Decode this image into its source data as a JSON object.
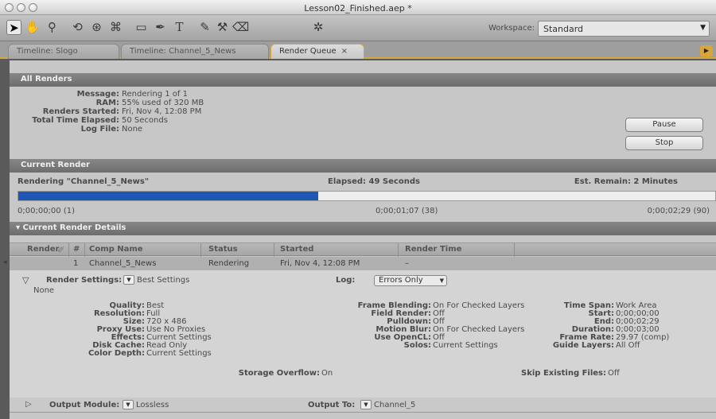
{
  "window": {
    "title": "Lesson02_Finished.aep *"
  },
  "toolbar": {
    "tools": [
      {
        "icon": "selection-arrow-icon",
        "glyph": "➤"
      },
      {
        "icon": "hand-icon",
        "glyph": "✋"
      },
      {
        "icon": "zoom-icon",
        "glyph": "⚲"
      },
      {
        "icon": "rotate-icon",
        "glyph": "⟲"
      },
      {
        "icon": "orbit-camera-icon",
        "glyph": "⊛"
      },
      {
        "icon": "pan-behind-icon",
        "glyph": "⌘"
      },
      {
        "icon": "rectangle-mask-icon",
        "glyph": "▭"
      },
      {
        "icon": "pen-icon",
        "glyph": "✒"
      },
      {
        "icon": "type-icon",
        "glyph": "T"
      },
      {
        "icon": "brush-icon",
        "glyph": "✎"
      },
      {
        "icon": "clone-stamp-icon",
        "glyph": "⚒"
      },
      {
        "icon": "eraser-icon",
        "glyph": "⌫"
      },
      {
        "icon": "puppet-pin-icon",
        "glyph": "✲"
      }
    ],
    "workspace_label": "Workspace:",
    "workspace_value": "Standard"
  },
  "tabs": [
    {
      "label": "Timeline: Slogo"
    },
    {
      "label": "Timeline: Channel_5_News"
    },
    {
      "label": "Render Queue",
      "close": "×"
    }
  ],
  "all_renders": {
    "header": "All Renders",
    "fields": [
      {
        "label": "Message:",
        "value": "Rendering 1 of 1"
      },
      {
        "label": "RAM:",
        "value": "55% used of 320 MB"
      },
      {
        "label": "Renders Started:",
        "value": "Fri, Nov 4, 12:08 PM"
      },
      {
        "label": "Total Time Elapsed:",
        "value": "50 Seconds"
      },
      {
        "label": "Log File:",
        "value": "None"
      }
    ],
    "pause_label": "Pause",
    "stop_label": "Stop"
  },
  "current_render": {
    "header": "Current Render",
    "rendering": "Rendering \"Channel_5_News\"",
    "elapsed": "Elapsed: 49 Seconds",
    "remain": "Est. Remain: 2 Minutes",
    "progress_fraction": 0.43,
    "time_start": "0;00;00;00 (1)",
    "time_current": "0;00;01;07 (38)",
    "time_end": "0;00;02;29 (90)"
  },
  "details_header": "Current Render Details",
  "queue_table": {
    "columns": [
      "Render",
      "#",
      "Comp Name",
      "Status",
      "Started",
      "Render Time"
    ],
    "row": {
      "number": "1",
      "comp": "Channel_5_News",
      "status": "Rendering",
      "started": "Fri, Nov 4, 12:08 PM",
      "render_time": "–"
    }
  },
  "render_settings": {
    "label": "Render Settings:",
    "value": "Best Settings",
    "sub": "None",
    "log_label": "Log:",
    "log_value": "Errors Only",
    "col1": [
      {
        "label": "Quality:",
        "value": "Best"
      },
      {
        "label": "Resolution:",
        "value": "Full"
      },
      {
        "label": "Size:",
        "value": "720 x 486"
      },
      {
        "label": "Proxy Use:",
        "value": "Use No Proxies"
      },
      {
        "label": "Effects:",
        "value": "Current Settings"
      },
      {
        "label": "Disk Cache:",
        "value": "Read Only"
      },
      {
        "label": "Color Depth:",
        "value": "Current Settings"
      }
    ],
    "col2": [
      {
        "label": "Frame Blending:",
        "value": "On For Checked Layers"
      },
      {
        "label": "Field Render:",
        "value": "Off"
      },
      {
        "label": "Pulldown:",
        "value": "Off"
      },
      {
        "label": "Motion Blur:",
        "value": "On For Checked Layers"
      },
      {
        "label": "Use OpenCL:",
        "value": "Off"
      },
      {
        "label": "Solos:",
        "value": "Current Settings"
      }
    ],
    "col3": [
      {
        "label": "Time Span:",
        "value": "Work Area"
      },
      {
        "label": "Start:",
        "value": "0;00;00;00"
      },
      {
        "label": "End:",
        "value": "0;00;02;29"
      },
      {
        "label": "Duration:",
        "value": "0;00;03;00"
      },
      {
        "label": "Frame Rate:",
        "value": "29.97 (comp)"
      },
      {
        "label": "Guide Layers:",
        "value": "All Off"
      }
    ],
    "storage_label": "Storage Overflow:",
    "storage_value": "On",
    "skip_label": "Skip Existing Files:",
    "skip_value": "Off"
  },
  "output_module": {
    "label": "Output Module:",
    "value": "Lossless",
    "output_to_label": "Output To:",
    "output_to_value": "Channel_5"
  }
}
